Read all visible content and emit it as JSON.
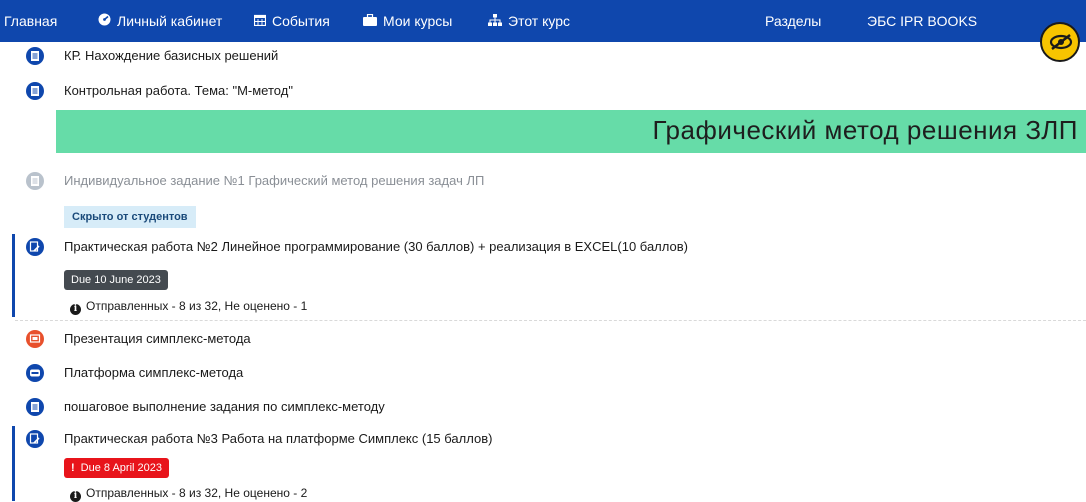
{
  "nav": {
    "items": [
      {
        "label": "Главная",
        "icon": ""
      },
      {
        "label": "Личный кабинет",
        "icon": "tachometer-icon"
      },
      {
        "label": "События",
        "icon": "calendar-icon"
      },
      {
        "label": "Мои курсы",
        "icon": "briefcase-icon"
      },
      {
        "label": "Этот курс",
        "icon": "sitemap-icon"
      },
      {
        "label": "Разделы",
        "icon": ""
      },
      {
        "label": "ЭБС IPR BOOKS",
        "icon": ""
      }
    ],
    "visibility_badge_icon": "eye-slash-icon",
    "colors": {
      "bar": "#0f47ad",
      "badge": "#f7c400"
    }
  },
  "activities_top": [
    {
      "label": "КР. Нахождение базисных решений",
      "icon": "file-icon"
    },
    {
      "label": "Контрольная работа. Тема: \"М-метод\"",
      "icon": "file-icon"
    }
  ],
  "section": {
    "title": "Графический метод решения ЗЛП",
    "color": "#66dca8"
  },
  "hidden_activity": {
    "label": "Индивидуальное задание №1 Графический метод решения задач ЛП",
    "icon": "file-icon",
    "badge": "Скрыто от студентов"
  },
  "assignment1": {
    "label": "Практическая работа №2 Линейное программирование (30 баллов) + реализация в EXCEL(10 баллов)",
    "icon": "assignment-icon",
    "due": "Due 10 June 2023",
    "status": "Отправленных - 8 из 32, Не оценено - 1"
  },
  "activities_mid": [
    {
      "label": "Презентация симплекс-метода",
      "icon": "presentation-icon",
      "color": "#e8502c"
    },
    {
      "label": "Платформа симплекс-метода",
      "icon": "url-icon",
      "color": "#0f47ad"
    },
    {
      "label": "пошаговое выполнение задания по симплекс-методу",
      "icon": "file-icon",
      "color": "#0f47ad"
    }
  ],
  "assignment2": {
    "label": "Практическая работа №3 Работа на платформе Симплекс (15 баллов)",
    "icon": "assignment-icon",
    "due": "Due 8 April 2023",
    "due_prefix": "!",
    "status": "Отправленных - 8 из 32, Не оценено - 2"
  }
}
